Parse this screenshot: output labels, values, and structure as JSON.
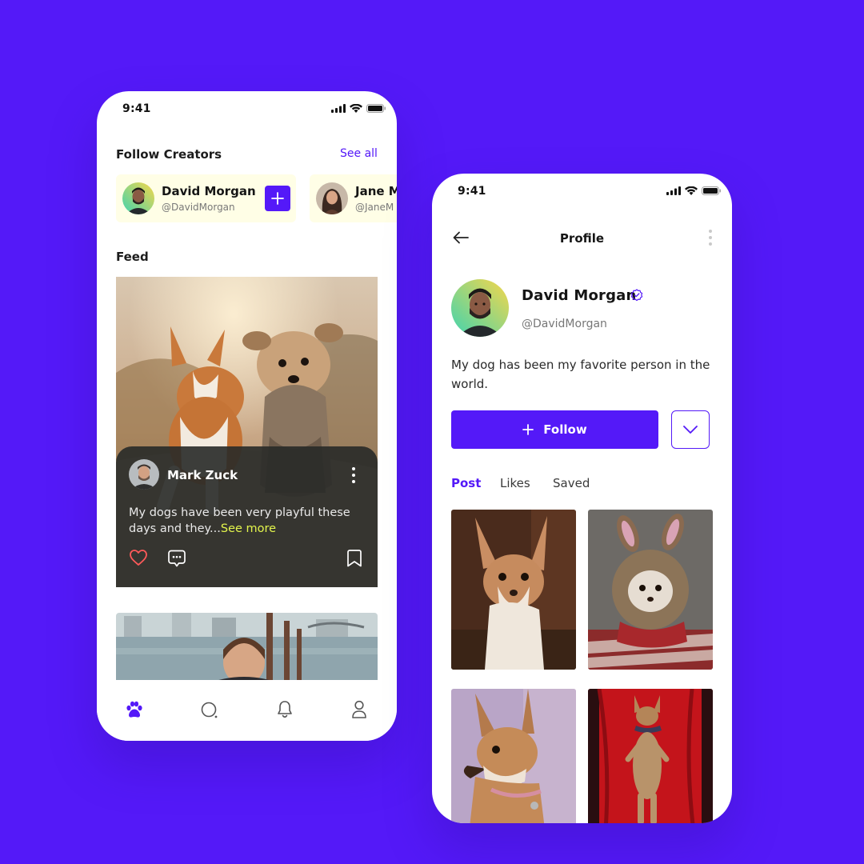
{
  "colors": {
    "background": "#5419F8",
    "accent": "#5419F8",
    "card": "#FFFEE6",
    "see_more": "#E3F54C",
    "like": "#FF5A5A"
  },
  "feed_screen": {
    "status_time": "9:41",
    "follow_creators": {
      "title": "Follow Creators",
      "see_all": "See all",
      "creators": [
        {
          "name": "David Morgan",
          "handle": "@DavidMorgan"
        },
        {
          "name": "Jane M",
          "handle": "@JaneM"
        }
      ]
    },
    "feed_title": "Feed",
    "post": {
      "author": "Mark Zuck",
      "text": "My dogs have been very playful these days and they...",
      "see_more": "See more"
    },
    "tab_bar": [
      "paw-icon",
      "search-icon",
      "bell-icon",
      "user-icon"
    ]
  },
  "profile_screen": {
    "status_time": "9:41",
    "nav_title": "Profile",
    "name": "David Morgan",
    "handle": "@DavidMorgan",
    "bio": "My dog has been my favorite person in the world.",
    "follow_label": "Follow",
    "tabs": [
      "Post",
      "Likes",
      "Saved"
    ],
    "active_tab": "Post"
  }
}
